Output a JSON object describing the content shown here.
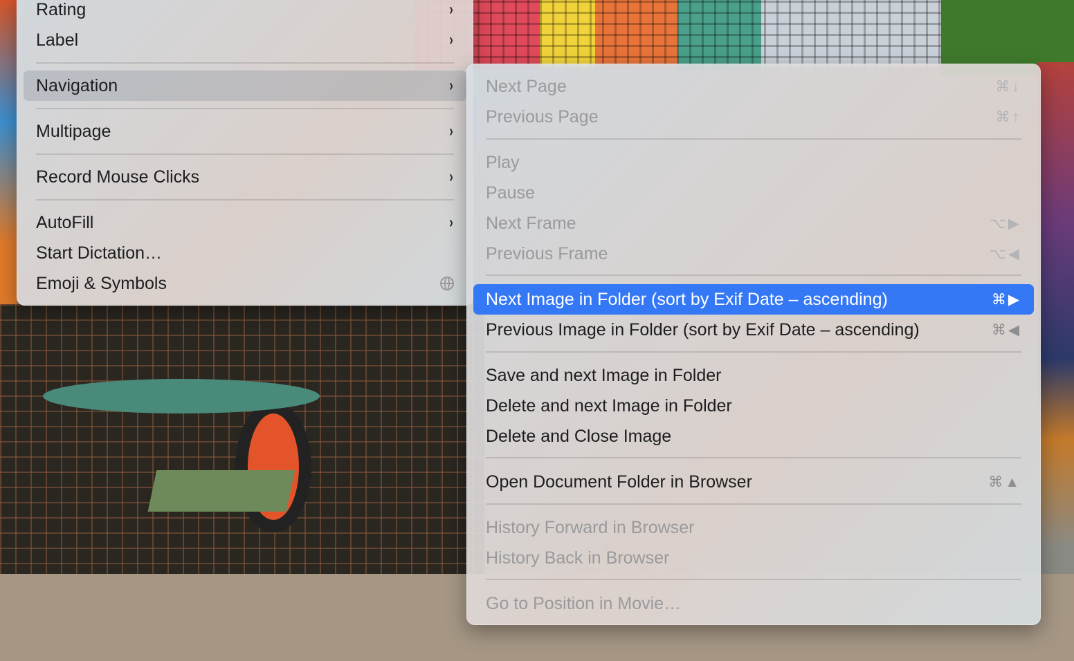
{
  "parent_menu": {
    "items": [
      {
        "label": "Rating",
        "submenu": true
      },
      {
        "label": "Label",
        "submenu": true
      },
      {
        "label": "Navigation",
        "submenu": true,
        "state": "open"
      },
      {
        "label": "Multipage",
        "submenu": true
      },
      {
        "label": "Record Mouse Clicks",
        "submenu": true
      },
      {
        "label": "AutoFill",
        "submenu": true
      },
      {
        "label": "Start Dictation…"
      },
      {
        "label": "Emoji & Symbols",
        "icon": "globe-icon"
      }
    ],
    "chevron": "›"
  },
  "navigation_submenu": {
    "items": [
      {
        "label": "Next Page",
        "shortcut": "⌘↓",
        "enabled": false
      },
      {
        "label": "Previous Page",
        "shortcut": "⌘↑",
        "enabled": false
      },
      {
        "label": "Play",
        "enabled": false
      },
      {
        "label": "Pause",
        "enabled": false
      },
      {
        "label": "Next Frame",
        "shortcut": "⌥▶",
        "enabled": false
      },
      {
        "label": "Previous Frame",
        "shortcut": "⌥◀",
        "enabled": false
      },
      {
        "label": "Next Image in Folder (sort by Exif Date – ascending)",
        "shortcut": "⌘▶",
        "enabled": true,
        "highlighted": true
      },
      {
        "label": "Previous Image in Folder (sort by Exif Date – ascending)",
        "shortcut": "⌘◀",
        "enabled": true
      },
      {
        "label": "Save and next Image in Folder",
        "enabled": true
      },
      {
        "label": "Delete and next Image in Folder",
        "enabled": true
      },
      {
        "label": "Delete and Close Image",
        "enabled": true
      },
      {
        "label": "Open Document Folder in Browser",
        "shortcut": "⌘▲",
        "enabled": true
      },
      {
        "label": "History Forward in Browser",
        "enabled": false
      },
      {
        "label": "History Back in Browser",
        "enabled": false
      },
      {
        "label": "Go to Position in Movie…",
        "enabled": false
      }
    ]
  },
  "colors": {
    "highlight": "#3478f6",
    "disabled_text": "#9a9a9c"
  }
}
